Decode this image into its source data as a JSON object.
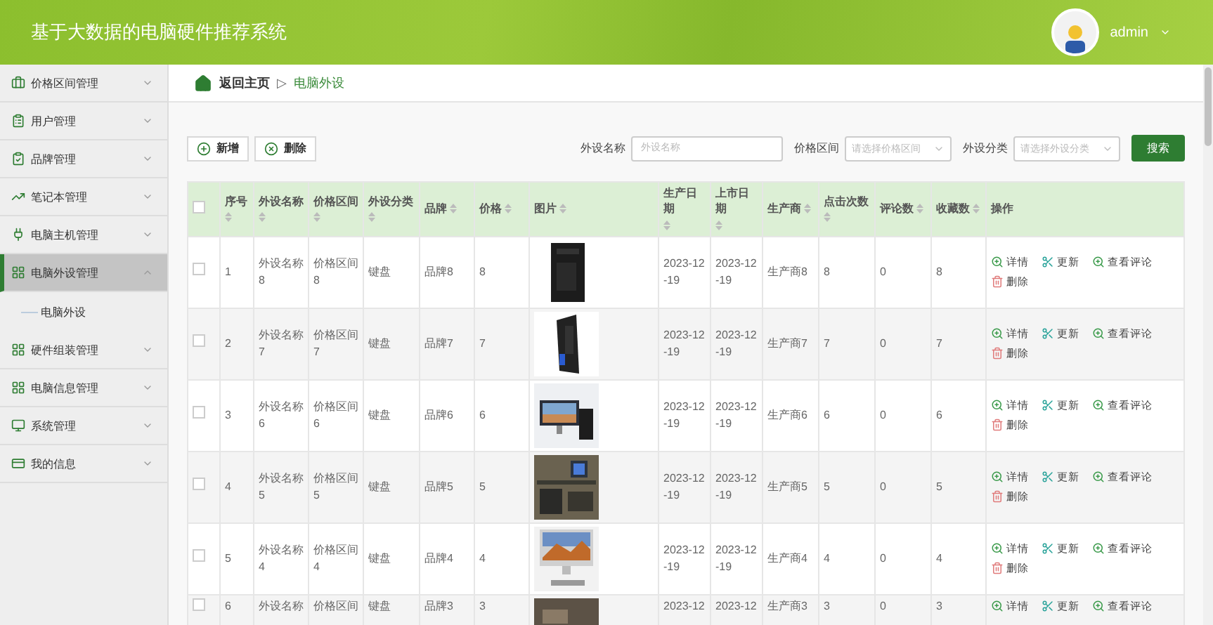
{
  "header": {
    "title": "基于大数据的电脑硬件推荐系统",
    "user": "admin"
  },
  "sidebar": {
    "items": [
      {
        "label": "价格区间管理",
        "expanded": false,
        "selected": false
      },
      {
        "label": "用户管理",
        "expanded": false,
        "selected": false
      },
      {
        "label": "品牌管理",
        "expanded": false,
        "selected": false
      },
      {
        "label": "笔记本管理",
        "expanded": false,
        "selected": false
      },
      {
        "label": "电脑主机管理",
        "expanded": false,
        "selected": false
      },
      {
        "label": "电脑外设管理",
        "expanded": true,
        "selected": true,
        "children": [
          {
            "label": "电脑外设"
          }
        ]
      },
      {
        "label": "硬件组装管理",
        "expanded": false,
        "selected": false
      },
      {
        "label": "电脑信息管理",
        "expanded": false,
        "selected": false
      },
      {
        "label": "系统管理",
        "expanded": false,
        "selected": false
      },
      {
        "label": "我的信息",
        "expanded": false,
        "selected": false
      }
    ]
  },
  "breadcrumb": {
    "home": "返回主页",
    "separator": "▷",
    "current": "电脑外设"
  },
  "toolbar": {
    "buttons": [
      {
        "label": "新增",
        "kind": "add"
      },
      {
        "label": "删除",
        "kind": "remove"
      }
    ],
    "filters": [
      {
        "label": "外设名称",
        "placeholder": "外设名称",
        "kind": "input"
      },
      {
        "label": "价格区间",
        "placeholder": "请选择价格区间",
        "kind": "select"
      },
      {
        "label": "外设分类",
        "placeholder": "请选择外设分类",
        "kind": "select"
      }
    ],
    "search": "搜索"
  },
  "table": {
    "select_all": {
      "checked": false
    },
    "columns": [
      {
        "label": "序号",
        "sortable": true
      },
      {
        "label": "外设名称",
        "sortable": true
      },
      {
        "label": "价格区间",
        "sortable": true
      },
      {
        "label": "外设分类",
        "sortable": true
      },
      {
        "label": "品牌",
        "sortable": true
      },
      {
        "label": "价格",
        "sortable": true
      },
      {
        "label": "图片",
        "sortable": true
      },
      {
        "label": "生产日期",
        "sortable": true
      },
      {
        "label": "上市日期",
        "sortable": true
      },
      {
        "label": "生产商",
        "sortable": true
      },
      {
        "label": "点击次数",
        "sortable": true
      },
      {
        "label": "评论数",
        "sortable": true
      },
      {
        "label": "收藏数",
        "sortable": true
      },
      {
        "label": "操作",
        "sortable": false
      }
    ],
    "rows": [
      {
        "checked": false,
        "cells": [
          "1",
          "外设名称8",
          "价格区间8",
          "键盘",
          "品牌8",
          "8",
          {
            "kind": "picture"
          },
          "2023-12-19",
          "2023-12-19",
          "生产商8",
          "8",
          "0",
          "8"
        ],
        "actions": [
          {
            "label": "详情",
            "kind": "view"
          },
          {
            "label": "更新",
            "kind": "edit"
          },
          {
            "label": "查看评论",
            "kind": "view"
          },
          {
            "label": "删除",
            "kind": "delete"
          }
        ]
      },
      {
        "checked": false,
        "cells": [
          "2",
          "外设名称7",
          "价格区间7",
          "键盘",
          "品牌7",
          "7",
          {
            "kind": "picture"
          },
          "2023-12-19",
          "2023-12-19",
          "生产商7",
          "7",
          "0",
          "7"
        ],
        "actions": [
          {
            "label": "详情",
            "kind": "view"
          },
          {
            "label": "更新",
            "kind": "edit"
          },
          {
            "label": "查看评论",
            "kind": "view"
          },
          {
            "label": "删除",
            "kind": "delete"
          }
        ]
      },
      {
        "checked": false,
        "cells": [
          "3",
          "外设名称6",
          "价格区间6",
          "键盘",
          "品牌6",
          "6",
          {
            "kind": "picture"
          },
          "2023-12-19",
          "2023-12-19",
          "生产商6",
          "6",
          "0",
          "6"
        ],
        "actions": [
          {
            "label": "详情",
            "kind": "view"
          },
          {
            "label": "更新",
            "kind": "edit"
          },
          {
            "label": "查看评论",
            "kind": "view"
          },
          {
            "label": "删除",
            "kind": "delete"
          }
        ]
      },
      {
        "checked": false,
        "cells": [
          "4",
          "外设名称5",
          "价格区间5",
          "键盘",
          "品牌5",
          "5",
          {
            "kind": "picture"
          },
          "2023-12-19",
          "2023-12-19",
          "生产商5",
          "5",
          "0",
          "5"
        ],
        "actions": [
          {
            "label": "详情",
            "kind": "view"
          },
          {
            "label": "更新",
            "kind": "edit"
          },
          {
            "label": "查看评论",
            "kind": "view"
          },
          {
            "label": "删除",
            "kind": "delete"
          }
        ]
      },
      {
        "checked": false,
        "cells": [
          "5",
          "外设名称4",
          "价格区间4",
          "键盘",
          "品牌4",
          "4",
          {
            "kind": "picture"
          },
          "2023-12-19",
          "2023-12-19",
          "生产商4",
          "4",
          "0",
          "4"
        ],
        "actions": [
          {
            "label": "详情",
            "kind": "view"
          },
          {
            "label": "更新",
            "kind": "edit"
          },
          {
            "label": "查看评论",
            "kind": "view"
          },
          {
            "label": "删除",
            "kind": "delete"
          }
        ]
      },
      {
        "checked": false,
        "cells": [
          "6",
          "外设名称",
          "价格区间",
          "键盘",
          "品牌3",
          "3",
          {
            "kind": "picture"
          },
          "2023-12",
          "2023-12",
          "生产商3",
          "3",
          "0",
          "3"
        ],
        "actions": [
          {
            "label": "详情",
            "kind": "view"
          },
          {
            "label": "更新",
            "kind": "edit"
          },
          {
            "label": "查看评论",
            "kind": "view"
          }
        ]
      }
    ]
  }
}
